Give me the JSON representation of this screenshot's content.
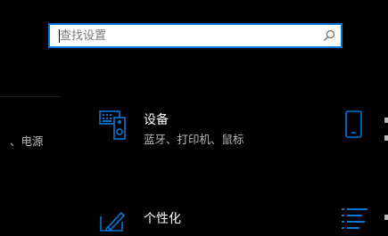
{
  "search": {
    "placeholder": "查找设置"
  },
  "left_partial": {
    "text": "、电源"
  },
  "tiles": [
    {
      "title": "设备",
      "subtitle": "蓝牙、打印机、鼠标",
      "icon": "keyboard-speaker-icon"
    },
    {
      "title": "个性化",
      "subtitle": "",
      "icon": "paintbrush-tablet-icon"
    }
  ],
  "right_tiles": [
    {
      "icon": "phone-icon"
    },
    {
      "icon": "list-icon"
    }
  ],
  "colors": {
    "accent": "#0078d7",
    "background": "#000000",
    "subtext": "#b8b8b8"
  }
}
